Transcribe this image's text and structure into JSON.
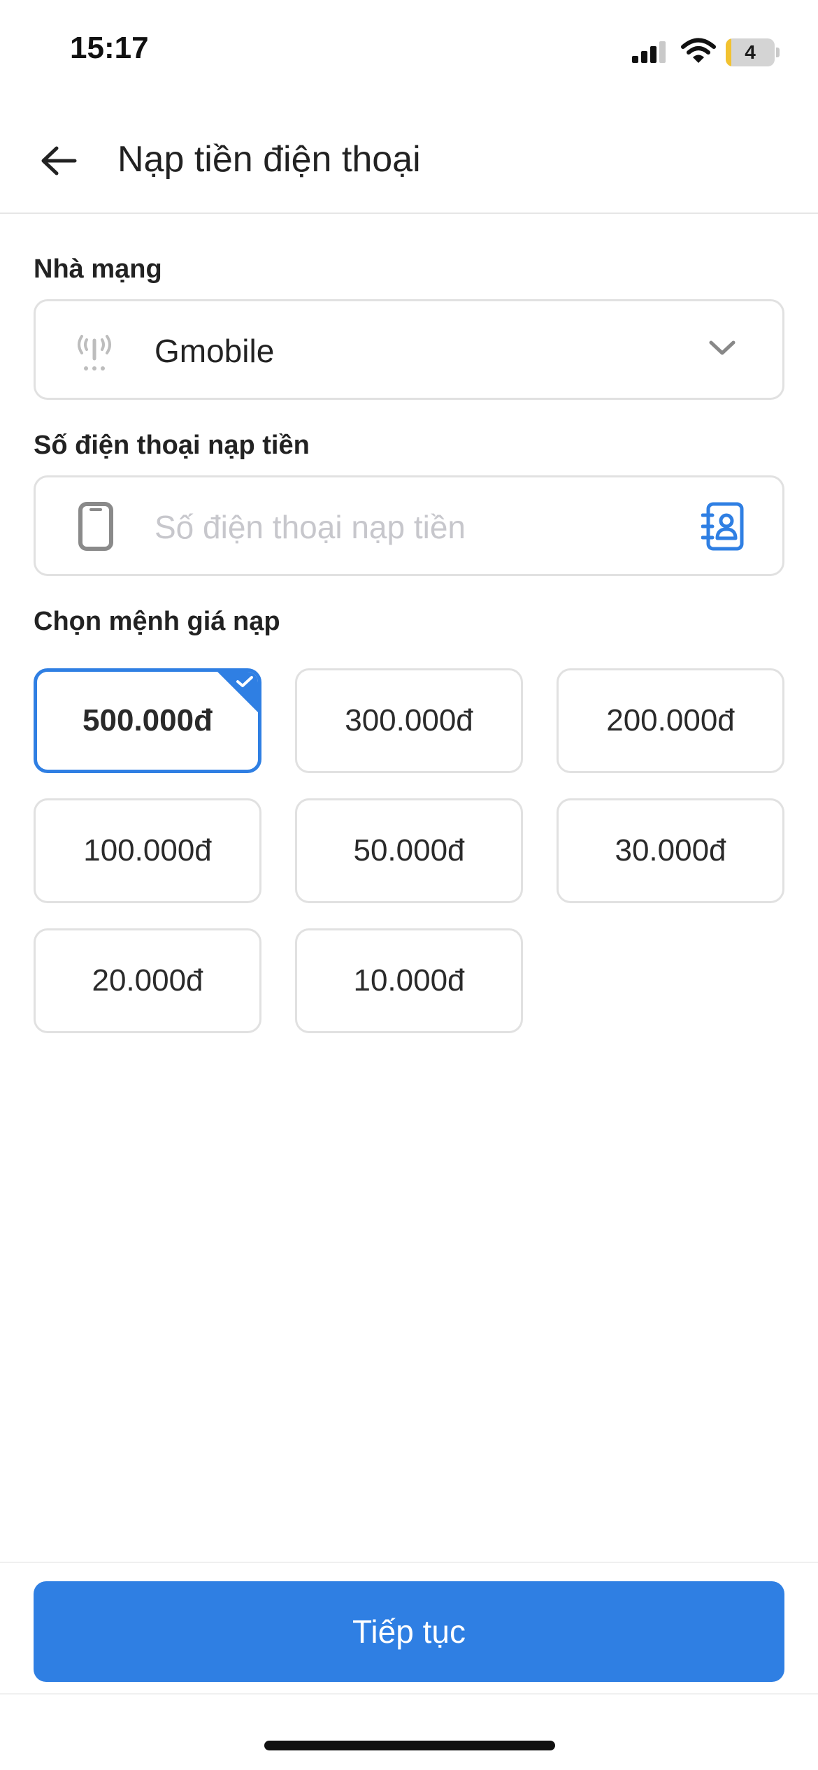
{
  "status_bar": {
    "time": "15:17",
    "battery_level": "4",
    "icons": [
      "signal-icon",
      "wifi-icon",
      "battery-icon"
    ]
  },
  "header": {
    "title": "Nạp tiền điện thoại",
    "back_icon": "arrow-left-icon"
  },
  "carrier": {
    "label": "Nhà mạng",
    "selected": "Gmobile",
    "icon": "antenna-icon"
  },
  "phone": {
    "label": "Số điện thoại nạp tiền",
    "placeholder": "Số điện thoại nạp tiền",
    "value": "",
    "icon": "phone-icon",
    "action_icon": "contact-book-icon"
  },
  "amounts": {
    "label": "Chọn mệnh giá nạp",
    "selected_index": 0,
    "options": [
      "500.000đ",
      "300.000đ",
      "200.000đ",
      "100.000đ",
      "50.000đ",
      "30.000đ",
      "20.000đ",
      "10.000đ"
    ]
  },
  "footer": {
    "continue_label": "Tiếp tục"
  },
  "colors": {
    "accent": "#2f7fe3",
    "border": "#e1e1e1",
    "text": "#222222",
    "placeholder": "#c7c7cc"
  }
}
